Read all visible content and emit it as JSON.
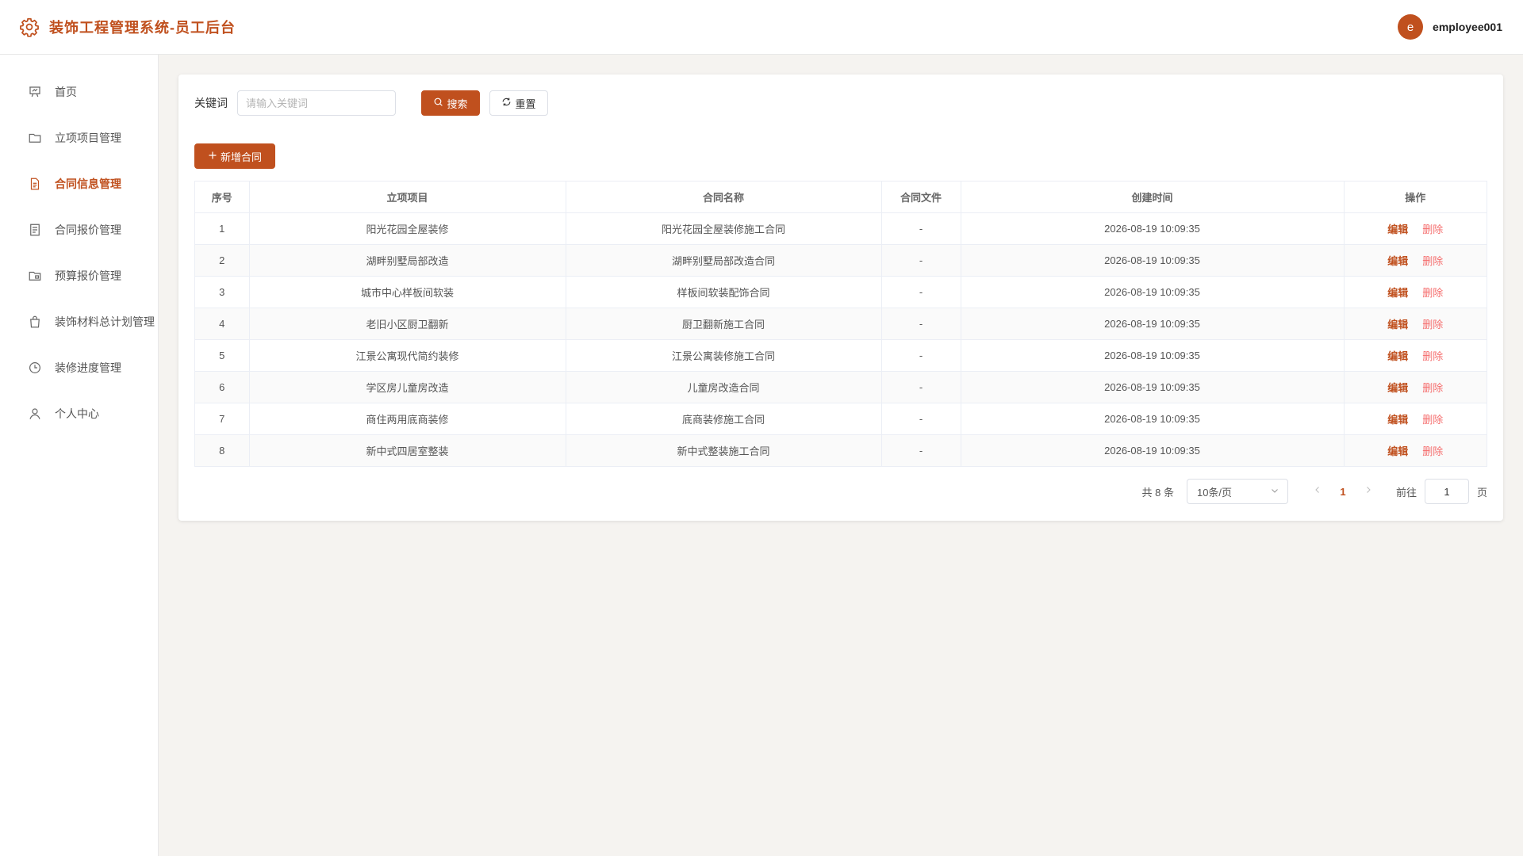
{
  "colors": {
    "accent": "#c0501e",
    "danger": "#f56c6c"
  },
  "header": {
    "title": "装饰工程管理系统-员工后台",
    "icon": "gear-icon",
    "avatar_letter": "e",
    "username": "employee001"
  },
  "sidebar": {
    "items": [
      {
        "label": "首页",
        "icon": "presentation-chart-icon"
      },
      {
        "label": "立项项目管理",
        "icon": "folder-icon"
      },
      {
        "label": "合同信息管理",
        "icon": "document-icon",
        "active": true
      },
      {
        "label": "合同报价管理",
        "icon": "tickets-icon"
      },
      {
        "label": "预算报价管理",
        "icon": "folder-opened-icon"
      },
      {
        "label": "装饰材料总计划管理",
        "icon": "shopping-bag-icon"
      },
      {
        "label": "装修进度管理",
        "icon": "clock-icon"
      },
      {
        "label": "个人中心",
        "icon": "user-icon"
      }
    ]
  },
  "search": {
    "label": "关键词",
    "placeholder": "请输入关键词",
    "value": "",
    "search_button": "搜索",
    "reset_button": "重置"
  },
  "toolbar": {
    "add_button": "新增合同"
  },
  "table": {
    "columns": [
      "序号",
      "立项项目",
      "合同名称",
      "合同文件",
      "创建时间",
      "操作"
    ],
    "rows": [
      {
        "index": "1",
        "project": "阳光花园全屋装修",
        "name": "阳光花园全屋装修施工合同",
        "file": "-",
        "created": "2026-08-19 10:09:35"
      },
      {
        "index": "2",
        "project": "湖畔别墅局部改造",
        "name": "湖畔别墅局部改造合同",
        "file": "-",
        "created": "2026-08-19 10:09:35"
      },
      {
        "index": "3",
        "project": "城市中心样板间软装",
        "name": "样板间软装配饰合同",
        "file": "-",
        "created": "2026-08-19 10:09:35"
      },
      {
        "index": "4",
        "project": "老旧小区厨卫翻新",
        "name": "厨卫翻新施工合同",
        "file": "-",
        "created": "2026-08-19 10:09:35"
      },
      {
        "index": "5",
        "project": "江景公寓现代简约装修",
        "name": "江景公寓装修施工合同",
        "file": "-",
        "created": "2026-08-19 10:09:35"
      },
      {
        "index": "6",
        "project": "学区房儿童房改造",
        "name": "儿童房改造合同",
        "file": "-",
        "created": "2026-08-19 10:09:35"
      },
      {
        "index": "7",
        "project": "商住两用底商装修",
        "name": "底商装修施工合同",
        "file": "-",
        "created": "2026-08-19 10:09:35"
      },
      {
        "index": "8",
        "project": "新中式四居室整装",
        "name": "新中式整装施工合同",
        "file": "-",
        "created": "2026-08-19 10:09:35"
      }
    ],
    "edit_label": "编辑",
    "delete_label": "删除"
  },
  "pagination": {
    "total_text": "共 8 条",
    "page_size": "10条/页",
    "current_page": "1",
    "goto_label": "前往",
    "goto_value": "1",
    "page_suffix": "页"
  }
}
